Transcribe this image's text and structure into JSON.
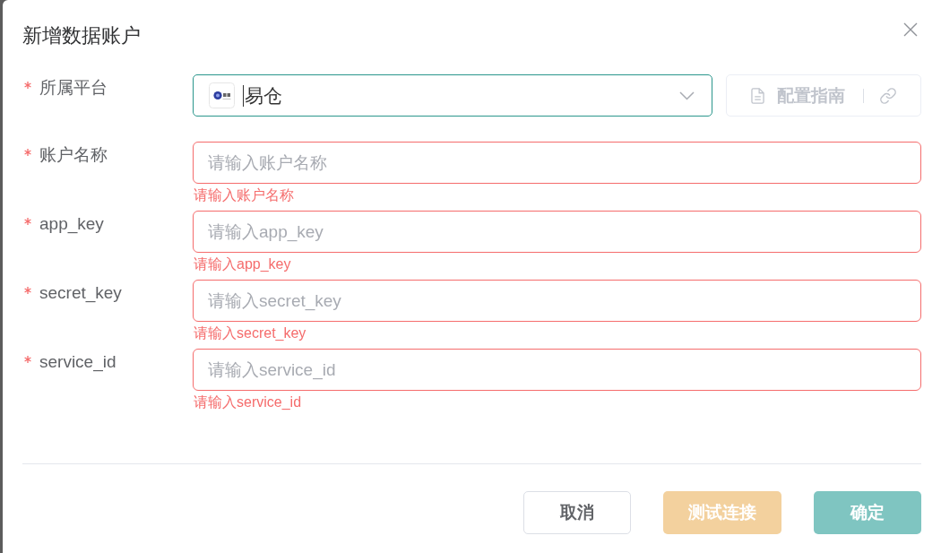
{
  "dialog": {
    "title": "新增数据账户"
  },
  "fields": [
    {
      "kind": "select",
      "label": "所属平台",
      "required": true,
      "focused": true,
      "value": "易仓",
      "guide_button": {
        "label": "配置指南",
        "disabled": true
      }
    },
    {
      "kind": "input",
      "label": "账户名称",
      "required": true,
      "placeholder": "请输入账户名称",
      "error": "请输入账户名称"
    },
    {
      "kind": "input",
      "label": "app_key",
      "required": true,
      "placeholder": "请输入app_key",
      "error": "请输入app_key"
    },
    {
      "kind": "input",
      "label": "secret_key",
      "required": true,
      "placeholder": "请输入secret_key",
      "error": "请输入secret_key"
    },
    {
      "kind": "input",
      "label": "service_id",
      "required": true,
      "placeholder": "请输入service_id",
      "error": "请输入service_id"
    }
  ],
  "buttons": [
    {
      "kind": "default",
      "label": "取消",
      "disabled": false
    },
    {
      "kind": "warning",
      "label": "测试连接",
      "disabled": true
    },
    {
      "kind": "primary",
      "label": "确定",
      "disabled": true
    }
  ]
}
